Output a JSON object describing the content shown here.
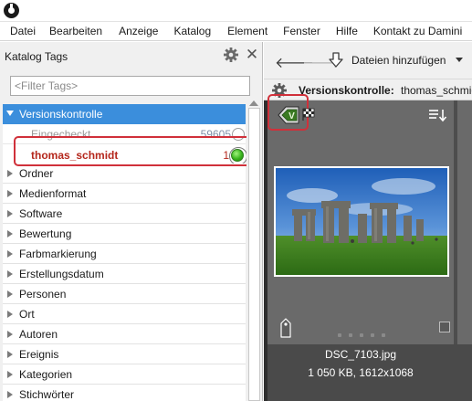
{
  "menu": [
    "Datei",
    "Bearbeiten",
    "Anzeige",
    "Katalog",
    "Element",
    "Fenster",
    "Hilfe",
    "Kontakt zu Damini"
  ],
  "left_panel": {
    "title": "Katalog Tags",
    "filter_placeholder": "<Filter Tags>",
    "selected_category": "Versionskontrolle",
    "sub_items": [
      {
        "label": "Eingecheckt",
        "count": "59605",
        "state": "unchecked"
      },
      {
        "label": "thomas_schmidt",
        "count": "1",
        "state": "active"
      }
    ],
    "categories": [
      "Ordner",
      "Medienformat",
      "Software",
      "Bewertung",
      "Farbmarkierung",
      "Erstellungsdatum",
      "Personen",
      "Ort",
      "Autoren",
      "Ereignis",
      "Kategorien",
      "Stichwörter"
    ]
  },
  "toolbar": {
    "add_files_label": "Dateien hinzufügen"
  },
  "infobar": {
    "key": "Versionskontrolle:",
    "value": "thomas_schmidt"
  },
  "image": {
    "filename": "DSC_7103.jpg",
    "meta": "1 050 KB, 1612x1068",
    "version_badge": "V"
  },
  "colors": {
    "selection": "#3b8edc",
    "highlight": "#d0303a",
    "active_item": "#b5271c",
    "viewer_bg": "#4d4d4d"
  }
}
